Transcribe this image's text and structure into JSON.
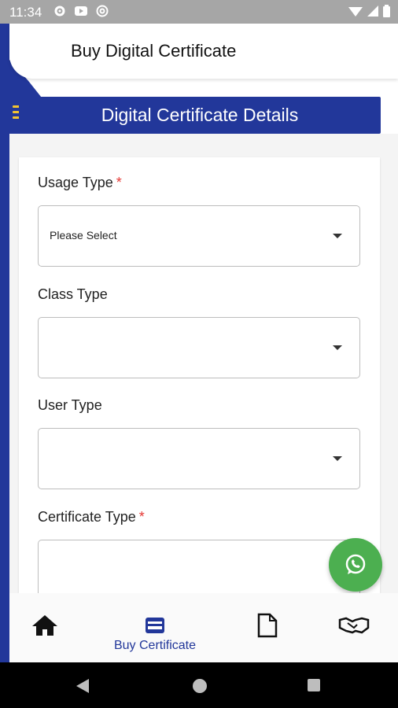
{
  "status_bar": {
    "time": "11:34"
  },
  "header": {
    "title": "Buy Digital Certificate"
  },
  "section": {
    "title": "Digital Certificate Details"
  },
  "form": {
    "usage_type": {
      "label": "Usage Type",
      "required_mark": "*",
      "value": "Please Select"
    },
    "class_type": {
      "label": "Class Type",
      "value": ""
    },
    "user_type": {
      "label": "User Type",
      "value": ""
    },
    "certificate_type": {
      "label": "Certificate Type",
      "required_mark": "*",
      "value": ""
    }
  },
  "bottom_nav": {
    "items": [
      {
        "icon": "home-icon",
        "label": ""
      },
      {
        "icon": "card-icon",
        "label": "Buy Certificate"
      },
      {
        "icon": "document-icon",
        "label": ""
      },
      {
        "icon": "handshake-icon",
        "label": ""
      }
    ]
  },
  "colors": {
    "primary": "#22379a",
    "fab": "#4caf50",
    "required": "#e53935",
    "menu_icon": "#f4c430"
  }
}
